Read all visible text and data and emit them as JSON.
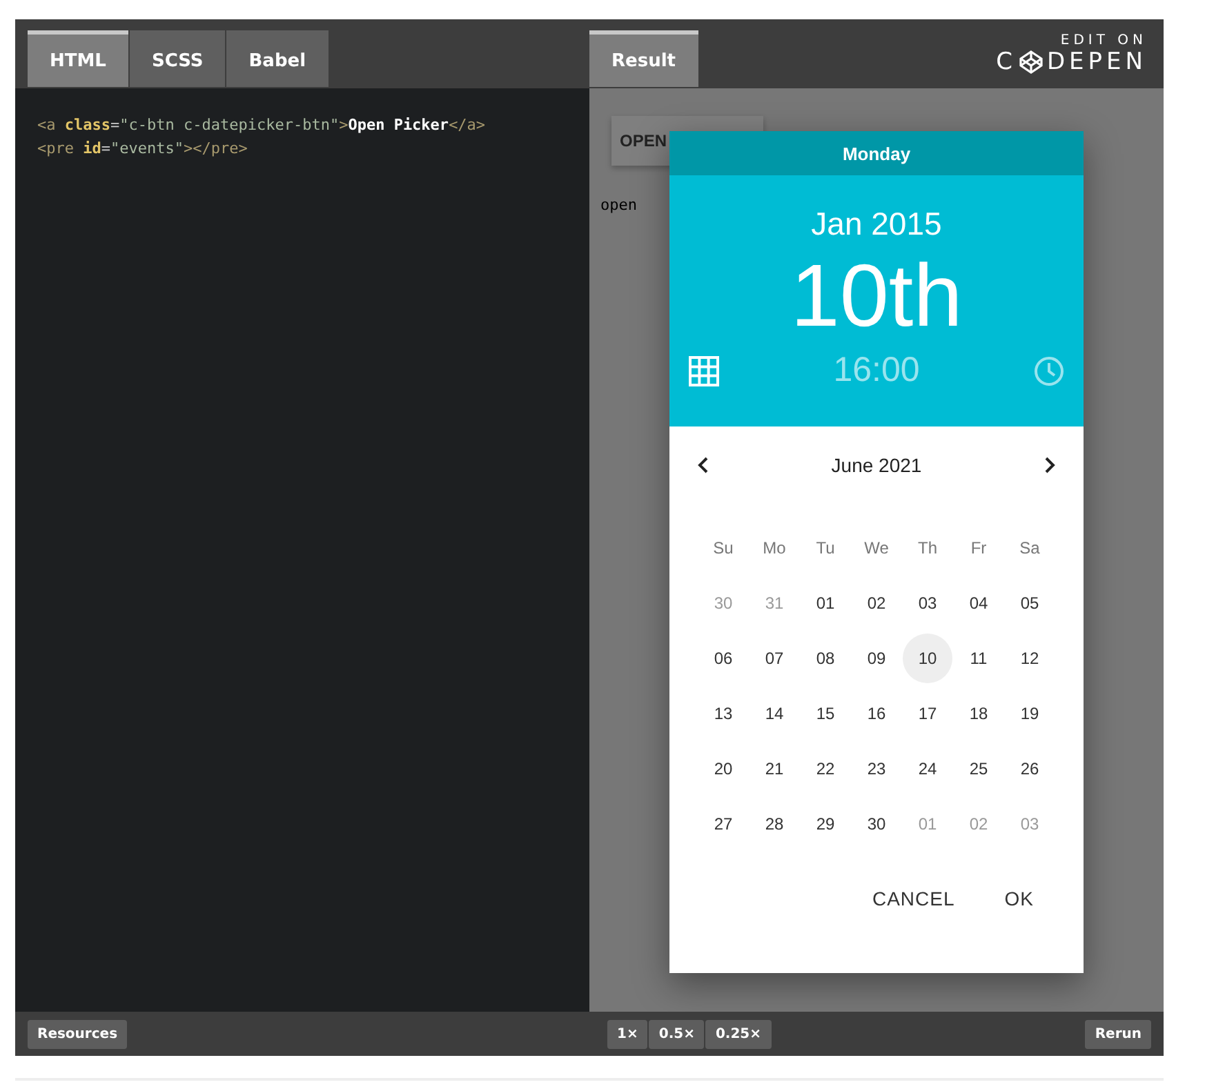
{
  "editor_tabs": [
    {
      "label": "HTML",
      "selected": true
    },
    {
      "label": "SCSS",
      "selected": false
    },
    {
      "label": "Babel",
      "selected": false
    }
  ],
  "code_lines": [
    [
      {
        "kind": "tag",
        "text": "<a "
      },
      {
        "kind": "attr",
        "text": "class"
      },
      {
        "kind": "punct",
        "text": "="
      },
      {
        "kind": "string",
        "text": "\"c-btn c-datepicker-btn\""
      },
      {
        "kind": "tag",
        "text": ">"
      },
      {
        "kind": "text",
        "text": "Open Picker"
      },
      {
        "kind": "tag",
        "text": "</a>"
      }
    ],
    [
      {
        "kind": "tag",
        "text": "<pre "
      },
      {
        "kind": "attr",
        "text": "id"
      },
      {
        "kind": "punct",
        "text": "="
      },
      {
        "kind": "string",
        "text": "\"events\""
      },
      {
        "kind": "tag",
        "text": "></pre>"
      }
    ]
  ],
  "result_tab": {
    "label": "Result",
    "selected": true
  },
  "codepen": {
    "edit_on": "EDIT ON",
    "brand_start": "C",
    "brand_end": "DEPEN"
  },
  "result": {
    "button": "OPEN",
    "log": "open"
  },
  "picker": {
    "weekday": "Monday",
    "month_year": "Jan 2015",
    "day": "10th",
    "time": "16:00",
    "nav_month": "June 2021",
    "weekdays": [
      "Su",
      "Mo",
      "Tu",
      "We",
      "Th",
      "Fr",
      "Sa"
    ],
    "weeks": [
      [
        {
          "d": "30",
          "muted": true,
          "selected": false
        },
        {
          "d": "31",
          "muted": true,
          "selected": false
        },
        {
          "d": "01",
          "muted": false,
          "selected": false
        },
        {
          "d": "02",
          "muted": false,
          "selected": false
        },
        {
          "d": "03",
          "muted": false,
          "selected": false
        },
        {
          "d": "04",
          "muted": false,
          "selected": false
        },
        {
          "d": "05",
          "muted": false,
          "selected": false
        }
      ],
      [
        {
          "d": "06",
          "muted": false,
          "selected": false
        },
        {
          "d": "07",
          "muted": false,
          "selected": false
        },
        {
          "d": "08",
          "muted": false,
          "selected": false
        },
        {
          "d": "09",
          "muted": false,
          "selected": false
        },
        {
          "d": "10",
          "muted": false,
          "selected": true
        },
        {
          "d": "11",
          "muted": false,
          "selected": false
        },
        {
          "d": "12",
          "muted": false,
          "selected": false
        }
      ],
      [
        {
          "d": "13",
          "muted": false,
          "selected": false
        },
        {
          "d": "14",
          "muted": false,
          "selected": false
        },
        {
          "d": "15",
          "muted": false,
          "selected": false
        },
        {
          "d": "16",
          "muted": false,
          "selected": false
        },
        {
          "d": "17",
          "muted": false,
          "selected": false
        },
        {
          "d": "18",
          "muted": false,
          "selected": false
        },
        {
          "d": "19",
          "muted": false,
          "selected": false
        }
      ],
      [
        {
          "d": "20",
          "muted": false,
          "selected": false
        },
        {
          "d": "21",
          "muted": false,
          "selected": false
        },
        {
          "d": "22",
          "muted": false,
          "selected": false
        },
        {
          "d": "23",
          "muted": false,
          "selected": false
        },
        {
          "d": "24",
          "muted": false,
          "selected": false
        },
        {
          "d": "25",
          "muted": false,
          "selected": false
        },
        {
          "d": "26",
          "muted": false,
          "selected": false
        }
      ],
      [
        {
          "d": "27",
          "muted": false,
          "selected": false
        },
        {
          "d": "28",
          "muted": false,
          "selected": false
        },
        {
          "d": "29",
          "muted": false,
          "selected": false
        },
        {
          "d": "30",
          "muted": false,
          "selected": false
        },
        {
          "d": "01",
          "muted": true,
          "selected": false
        },
        {
          "d": "02",
          "muted": true,
          "selected": false
        },
        {
          "d": "03",
          "muted": true,
          "selected": false
        }
      ]
    ],
    "buttons": [
      "CANCEL",
      "OK"
    ]
  },
  "footer": {
    "resources": "Resources",
    "zoom": [
      "1×",
      "0.5×",
      "0.25×"
    ],
    "rerun": "Rerun"
  }
}
